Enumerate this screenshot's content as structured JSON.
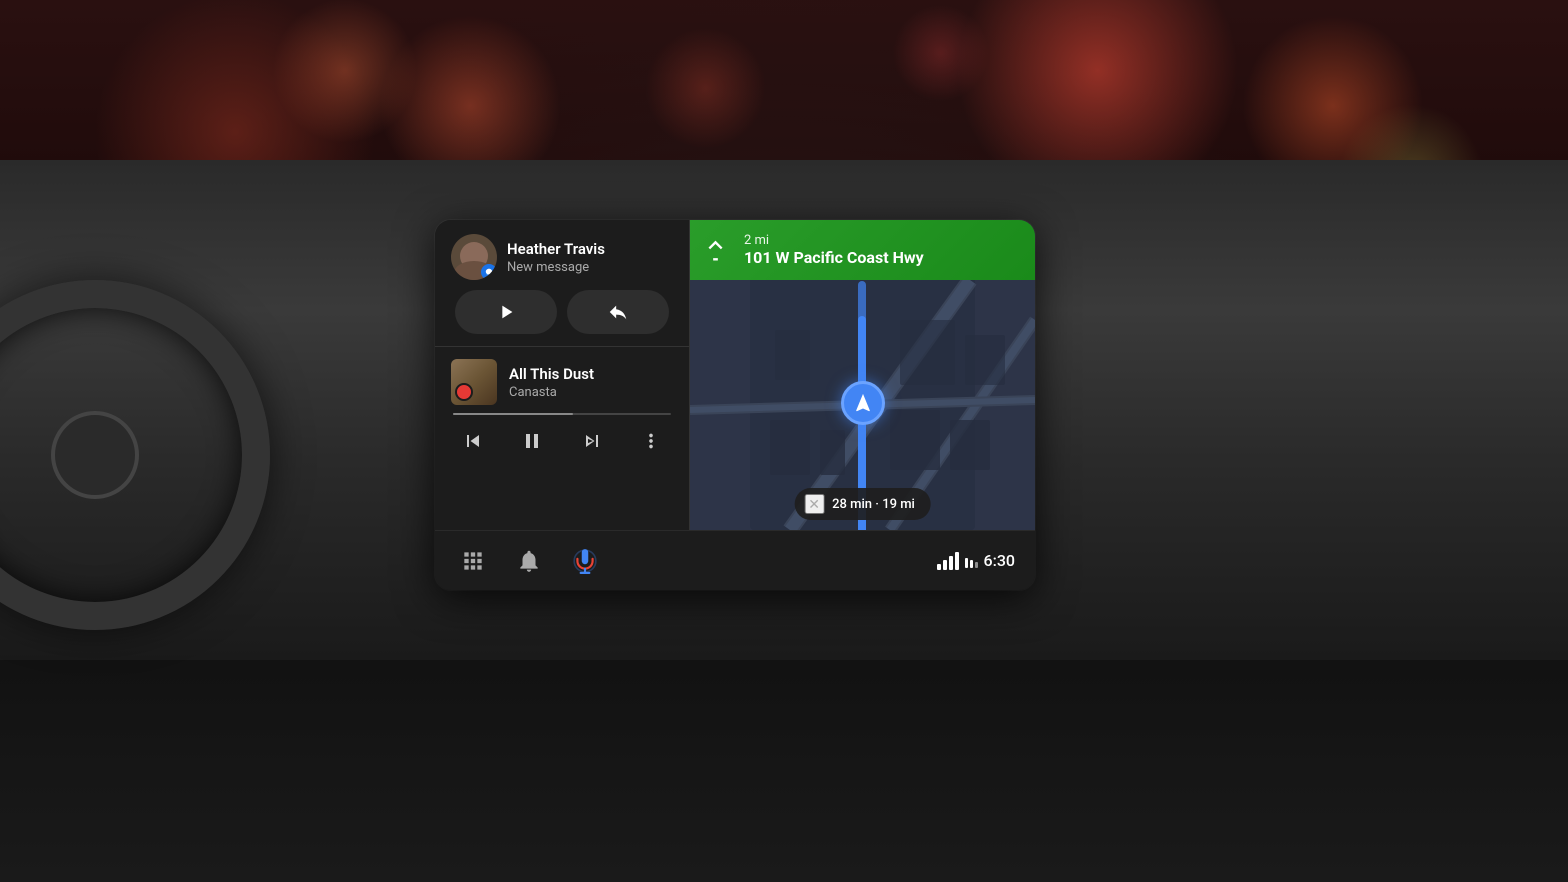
{
  "scene": {
    "bg_description": "Car interior dashboard with bokeh lights"
  },
  "screen": {
    "message": {
      "sender": "Heather Travis",
      "subtitle": "New message",
      "play_label": "Play",
      "reply_label": "Reply"
    },
    "music": {
      "track_title": "All This Dust",
      "artist": "Canasta",
      "progress_percent": 55
    },
    "music_controls": {
      "prev_label": "Previous",
      "pause_label": "Pause",
      "next_label": "Next",
      "more_label": "More options"
    },
    "bottom_bar": {
      "grid_label": "App grid",
      "notification_label": "Notifications",
      "mic_label": "Voice input",
      "time": "6:30"
    },
    "navigation": {
      "distance": "2 mi",
      "street": "101 W Pacific Coast Hwy",
      "eta": "28 min · 19 mi",
      "close_label": "Close"
    }
  }
}
